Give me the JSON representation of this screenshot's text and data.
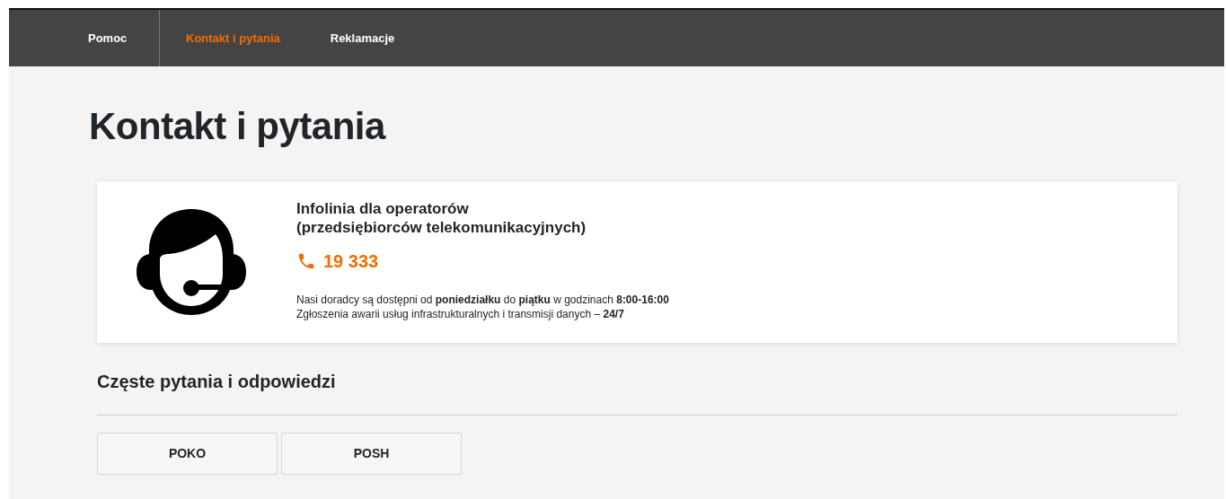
{
  "nav": {
    "brand": "Pomoc",
    "items": [
      {
        "label": "Kontakt i pytania",
        "selected": true
      },
      {
        "label": "Reklamacje",
        "selected": false
      }
    ]
  },
  "title": "Kontakt i pytania",
  "contact_card": {
    "heading_lines": [
      "Infolinia dla operatorów",
      "(przedsiębiorców telekomunikacyjnych)"
    ],
    "phone": "19 333",
    "notes": [
      "Nasi doradcy są dostępni od **poniedziałku** do **piątku** w godzinach **8:00-16:00**",
      "Zgłoszenia awarii usług infrastrukturalnych i transmisji danych – **24/7**"
    ]
  },
  "faq": {
    "heading": "Częste pytania i odpowiedzi",
    "buttons": [
      "POKO",
      "POSH"
    ]
  }
}
